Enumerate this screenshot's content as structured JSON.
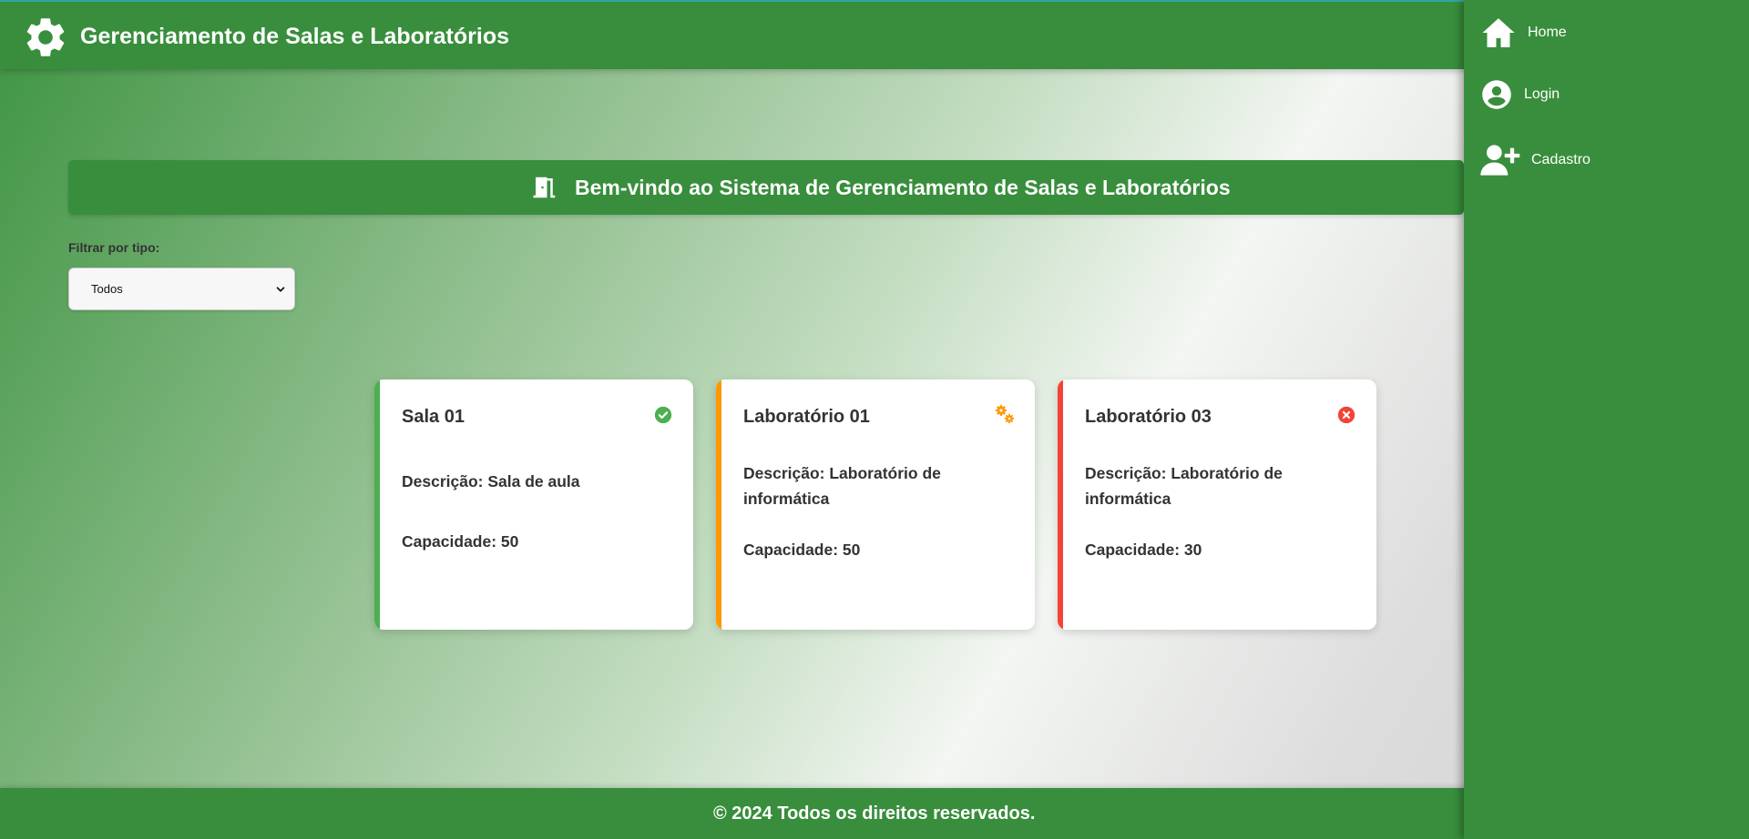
{
  "header": {
    "title": "Gerenciamento de Salas e Laboratórios"
  },
  "banner": {
    "text": "Bem-vindo ao Sistema de Gerenciamento de Salas e Laboratórios"
  },
  "filter": {
    "label": "Filtrar por tipo:",
    "selected": "Todos"
  },
  "cards": [
    {
      "title": "Sala 01",
      "description": "Descrição: Sala de aula",
      "capacity": "Capacidade: 50",
      "status_icon": "check-circle-icon",
      "accent_color": "#4caf50"
    },
    {
      "title": "Laboratório 01",
      "description": "Descrição: Laboratório de informática",
      "capacity": "Capacidade: 50",
      "status_icon": "gears-icon",
      "accent_color": "#ff9800"
    },
    {
      "title": "Laboratório 03",
      "description": "Descrição: Laboratório de informática",
      "capacity": "Capacidade: 30",
      "status_icon": "close-circle-icon",
      "accent_color": "#f44336"
    }
  ],
  "sidebar": {
    "items": [
      {
        "label": "Home",
        "icon": "home-icon"
      },
      {
        "label": "Login",
        "icon": "user-circle-icon"
      },
      {
        "label": "Cadastro",
        "icon": "user-plus-icon"
      }
    ]
  },
  "footer": {
    "text": "© 2024 Todos os direitos reservados."
  },
  "colors": {
    "primary_green": "#388e3c",
    "available": "#4caf50",
    "maintenance": "#ff9800",
    "unavailable": "#f44336"
  }
}
